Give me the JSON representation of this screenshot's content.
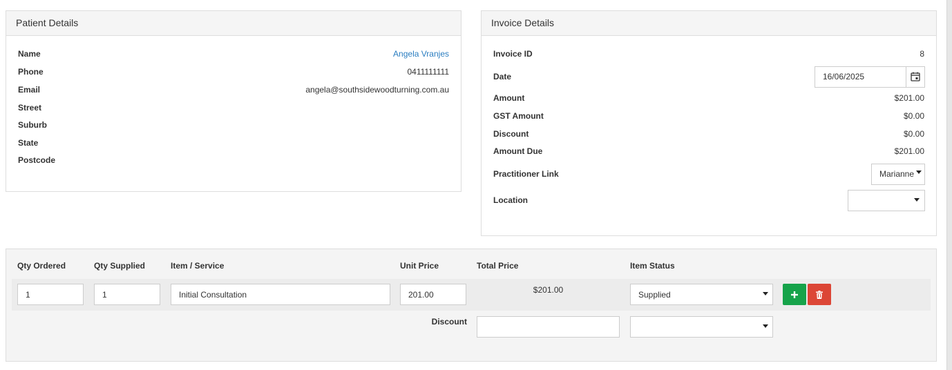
{
  "patient": {
    "heading": "Patient Details",
    "fields": [
      {
        "label": "Name",
        "value": "Angela Vranjes"
      },
      {
        "label": "Phone",
        "value": "0411111111"
      },
      {
        "label": "Email",
        "value": "angela@southsidewoodturning.com.au"
      },
      {
        "label": "Street",
        "value": ""
      },
      {
        "label": "Suburb",
        "value": ""
      },
      {
        "label": "State",
        "value": ""
      },
      {
        "label": "Postcode",
        "value": ""
      }
    ]
  },
  "invoice": {
    "heading": "Invoice Details",
    "id_label": "Invoice ID",
    "id_value": "8",
    "date_label": "Date",
    "date_value": "16/06/2025",
    "amount_label": "Amount",
    "amount_value": "$201.00",
    "gst_label": "GST Amount",
    "gst_value": "$0.00",
    "discount_label": "Discount",
    "discount_value": "$0.00",
    "due_label": "Amount Due",
    "due_value": "$201.00",
    "practitioner_label": "Practitioner Link",
    "practitioner_value": "Marianne",
    "location_label": "Location",
    "location_value": ""
  },
  "items": {
    "headers": {
      "qty_ordered": "Qty Ordered",
      "qty_supplied": "Qty Supplied",
      "item_service": "Item / Service",
      "unit_price": "Unit Price",
      "total_price": "Total Price",
      "item_status": "Item Status"
    },
    "rows": [
      {
        "qty_ordered": "1",
        "qty_supplied": "1",
        "item_service": "Initial Consultation",
        "unit_price": "201.00",
        "total_price": "$201.00",
        "item_status": "Supplied"
      }
    ],
    "discount_label": "Discount",
    "discount_value": "",
    "discount_status": ""
  },
  "colors": {
    "link": "#2a7dc0",
    "add_button": "#16a34a",
    "delete_button": "#dc4636"
  },
  "icons": {
    "calendar": "calendar-icon",
    "add": "plus-icon",
    "delete": "trash-icon"
  }
}
